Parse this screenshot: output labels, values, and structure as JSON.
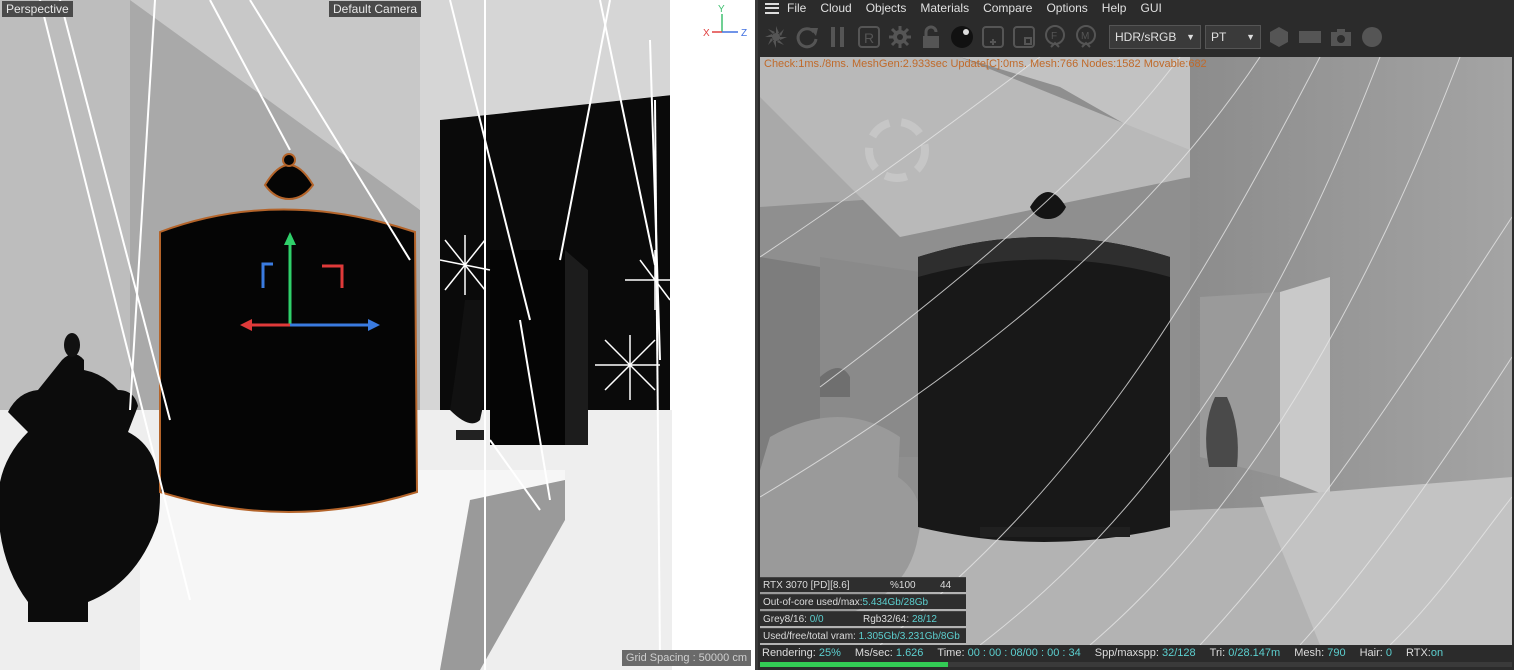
{
  "viewport": {
    "view_label": "Perspective",
    "camera_label": "Default Camera",
    "grid_spacing": "Grid Spacing : 50000 cm",
    "axes": {
      "x": "X",
      "y": "Y",
      "z": "Z"
    }
  },
  "menu": {
    "items": [
      "File",
      "Cloud",
      "Objects",
      "Materials",
      "Compare",
      "Options",
      "Help",
      "GUI"
    ]
  },
  "toolbar": {
    "icons": [
      "send-scene-icon",
      "restart-icon",
      "pause-icon",
      "region-icon",
      "settings-gear-icon",
      "lock-icon",
      "material-sphere-icon",
      "add-region-icon",
      "film-region-icon",
      "focus-pick-icon",
      "material-pick-icon"
    ],
    "color_space": "HDR/sRGB",
    "kernel": "PT",
    "trailing_icons": [
      "hexagon-icon",
      "rectangle-icon",
      "camera-icon",
      "circle-icon"
    ]
  },
  "render": {
    "status_line": "Check:1ms./8ms. MeshGen:2.933sec Update[C]:0ms. Mesh:766 Nodes:1582 Movable:682"
  },
  "gpu_info": {
    "gpu": "RTX 3070 [PD][8.6]",
    "percent": "%100",
    "temp": "44",
    "out_of_core_label": "Out-of-core used/max:",
    "out_of_core_value": "5.434Gb/28Gb",
    "grey_label": "Grey8/16:",
    "grey_value": "0/0",
    "rgb_label": "Rgb32/64:",
    "rgb_value": "28/12",
    "vram_label": "Used/free/total vram:",
    "vram_value": "1.305Gb/3.231Gb/8Gb"
  },
  "statusbar": {
    "rendering_label": "Rendering:",
    "rendering_value": "25%",
    "ms_label": "Ms/sec:",
    "ms_value": "1.626",
    "time_label": "Time:",
    "time_value": "00 : 00 : 08/00 : 00 : 34",
    "spp_label": "Spp/maxspp:",
    "spp_value": "32/128",
    "tri_label": "Tri:",
    "tri_value": "0/28.147m",
    "mesh_label": "Mesh:",
    "mesh_value": "790",
    "hair_label": "Hair:",
    "hair_value": "0",
    "rtx_label": "RTX:",
    "rtx_value": "on",
    "progress": 0.25
  }
}
